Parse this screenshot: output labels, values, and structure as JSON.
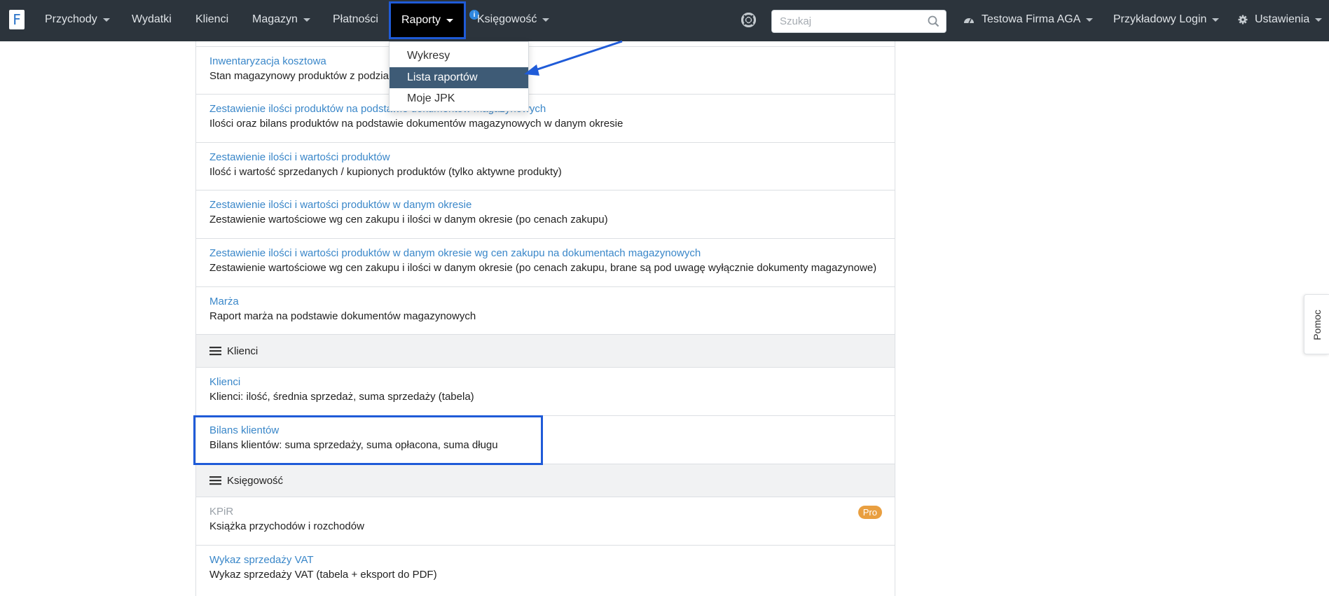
{
  "navbar": {
    "brand_letter": "F",
    "items": [
      {
        "label": "Przychody",
        "has_caret": true
      },
      {
        "label": "Wydatki",
        "has_caret": false
      },
      {
        "label": "Klienci",
        "has_caret": false
      },
      {
        "label": "Magazyn",
        "has_caret": true
      },
      {
        "label": "Płatności",
        "has_caret": false
      },
      {
        "label": "Raporty",
        "has_caret": true,
        "active": true
      },
      {
        "label": "Księgowość",
        "has_caret": true
      }
    ],
    "info_badge": "i",
    "search_placeholder": "Szukaj",
    "company": "Testowa Firma AGA",
    "login": "Przykładowy Login",
    "settings": "Ustawienia"
  },
  "dropdown": {
    "items": [
      {
        "label": "Wykresy",
        "active": false
      },
      {
        "label": "Lista raportów",
        "active": true
      },
      {
        "label": "Moje JPK",
        "active": false
      }
    ]
  },
  "reports": {
    "magazyn_rows": [
      {
        "title": "Inwentaryzacja kosztowa",
        "desc": "Stan magazynowy produktów z podziałem"
      },
      {
        "title": "Zestawienie ilości produktów na podstawie dokumentów magazynowych",
        "desc": "Ilości oraz bilans produktów na podstawie dokumentów magazynowych w danym okresie"
      },
      {
        "title": "Zestawienie ilości i wartości produktów",
        "desc": "Ilość i wartość sprzedanych / kupionych produktów (tylko aktywne produkty)"
      },
      {
        "title": "Zestawienie ilości i wartości produktów w danym okresie",
        "desc": "Zestawienie wartościowe wg cen zakupu i ilości w danym okresie (po cenach zakupu)"
      },
      {
        "title": "Zestawienie ilości i wartości produktów w danym okresie wg cen zakupu na dokumentach magazynowych",
        "desc": "Zestawienie wartościowe wg cen zakupu i ilości w danym okresie (po cenach zakupu, brane są pod uwagę wyłącznie dokumenty magazynowe)"
      },
      {
        "title": "Marża",
        "desc": "Raport marża na podstawie dokumentów magazynowych"
      }
    ],
    "section_klienci": "Klienci",
    "klienci_rows": [
      {
        "title": "Klienci",
        "desc": "Klienci: ilość, średnia sprzedaż, suma sprzedaży (tabela)"
      },
      {
        "title": "Bilans klientów",
        "desc": "Bilans klientów: suma sprzedaży, suma opłacona, suma długu"
      }
    ],
    "section_ksiegowosc": "Księgowość",
    "ksiegowosc_rows": [
      {
        "title": "KPiR",
        "desc": "Książka przychodów i rozchodów",
        "badge": "Pro",
        "muted": true
      },
      {
        "title": "Wykaz sprzedaży VAT",
        "desc": "Wykaz sprzedaży VAT (tabela + eksport do PDF)"
      }
    ]
  },
  "help_tab": "Pomoc",
  "colors": {
    "navbar_bg": "#2c343c",
    "link": "#3a87c9",
    "dropdown_active": "#3e5b76",
    "highlight": "#1f5bd8",
    "pro_badge": "#e99f40"
  }
}
